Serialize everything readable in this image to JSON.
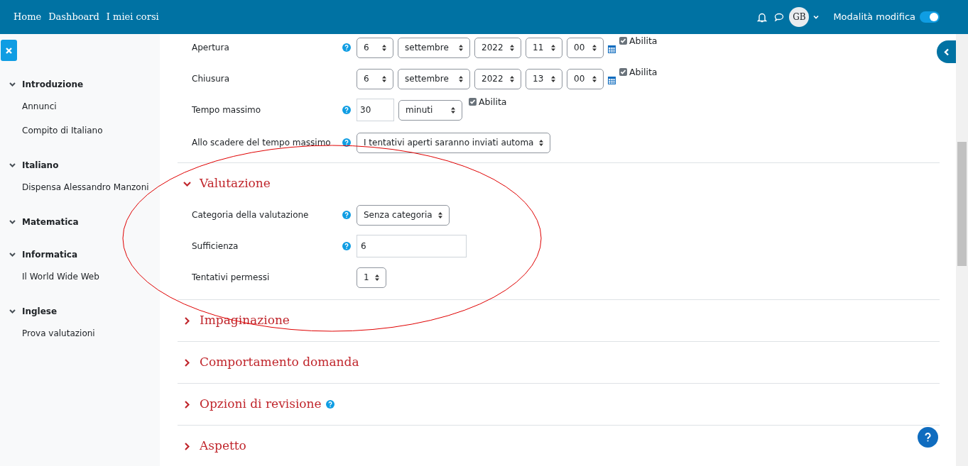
{
  "navbar": {
    "links": [
      "Home",
      "Dashboard",
      "I miei corsi"
    ],
    "avatar": "GB",
    "edit_mode": {
      "label": "Modalità modifica",
      "on": true
    }
  },
  "sidebar": {
    "sections": [
      {
        "title": "Introduzione",
        "expanded": true,
        "items": [
          "Annunci",
          "Compito di Italiano"
        ]
      },
      {
        "title": "Italiano",
        "expanded": true,
        "items": [
          "Dispensa Alessandro Manzoni"
        ]
      },
      {
        "title": "Matematica",
        "expanded": true
      },
      {
        "title": "Informatica",
        "expanded": true,
        "items": [
          "Il World Wide Web"
        ]
      },
      {
        "title": "Inglese",
        "expanded": true,
        "items": [
          "Prova valutazioni"
        ]
      }
    ]
  },
  "timing_rows": [
    {
      "kind": "datetime",
      "label": "Apertura",
      "help": true,
      "selects": [
        "6",
        "settembre",
        "2022",
        "11",
        "00"
      ],
      "enable": {
        "label": "Abilita",
        "checked": true
      }
    },
    {
      "kind": "datetime",
      "label": "Chiusura",
      "help": false,
      "selects": [
        "6",
        "settembre",
        "2022",
        "13",
        "00"
      ],
      "enable": {
        "label": "Abilita",
        "checked": true
      }
    },
    {
      "kind": "duration",
      "label": "Tempo massimo",
      "help": true,
      "value": "30",
      "unit": "minuti",
      "enable": {
        "label": "Abilita",
        "checked": true
      }
    },
    {
      "kind": "select",
      "label": "Allo scadere del tempo massimo",
      "help": true,
      "value": "I tentativi aperti saranno inviati automa"
    }
  ],
  "sections": [
    {
      "title": "Valutazione",
      "expanded": true,
      "help": false,
      "rows": [
        {
          "kind": "select",
          "label": "Categoria della valutazione",
          "help": true,
          "value": "Senza categoria"
        },
        {
          "kind": "text",
          "label": "Sufficienza",
          "help": true,
          "value": "6"
        },
        {
          "kind": "select",
          "label": "Tentativi permessi",
          "help": false,
          "value": "1"
        }
      ]
    },
    {
      "title": "Impaginazione",
      "expanded": false,
      "help": false
    },
    {
      "title": "Comportamento domanda",
      "expanded": false,
      "help": false
    },
    {
      "title": "Opzioni di revisione",
      "expanded": false,
      "help": true
    },
    {
      "title": "Aspetto",
      "expanded": false,
      "help": false
    }
  ]
}
